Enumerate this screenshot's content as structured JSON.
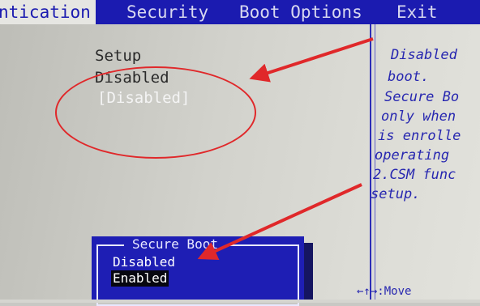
{
  "menu": {
    "tabs": [
      "ntication",
      "Security",
      "Boot Options",
      "Exit"
    ],
    "active_tab": "ntication"
  },
  "settings": {
    "value1": "Setup",
    "value2": "Disabled",
    "value3": "[Disabled]"
  },
  "help": {
    "lines": [
      "Disabled",
      "boot.",
      "Secure Bo",
      "only when",
      "is enrolle",
      "operating",
      "2.CSM func",
      "setup."
    ],
    "key_hint": "←↑→:Move"
  },
  "popup": {
    "title": "Secure Boot",
    "options": [
      "Disabled",
      "Enabled"
    ],
    "selected": "Enabled"
  },
  "colors": {
    "bios_blue": "#1b1bb0",
    "annotation_red": "#e0282a",
    "panel_bg": "#d2d2cc"
  }
}
